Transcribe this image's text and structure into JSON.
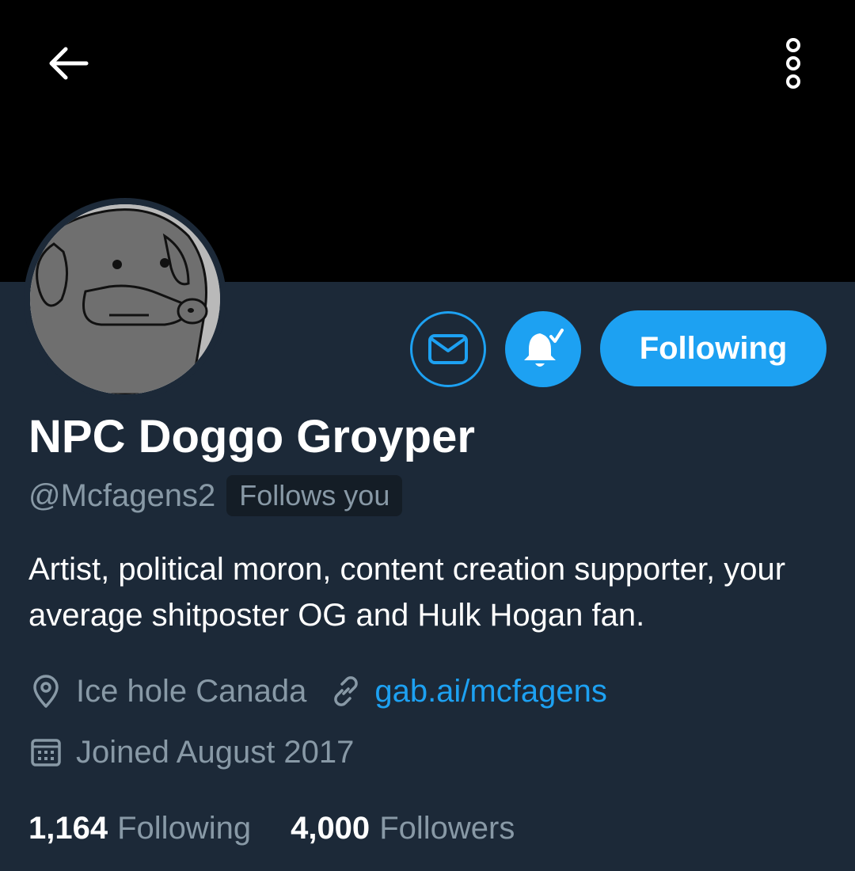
{
  "header": {
    "back_icon": "arrow-left-icon",
    "more_icon": "more-vertical-icon"
  },
  "profile": {
    "display_name": "NPC Doggo Groyper",
    "handle": "@Mcfagens2",
    "follows_you": "Follows you",
    "bio": "Artist, political moron, content creation supporter, your average shitposter OG and Hulk Hogan fan.",
    "location": "Ice hole Canada",
    "website": "gab.ai/mcfagens",
    "joined": "Joined August 2017"
  },
  "actions": {
    "message_icon": "envelope-icon",
    "notify_icon": "bell-check-icon",
    "follow_label": "Following"
  },
  "stats": {
    "following_count": "1,164",
    "following_label": "Following",
    "followers_count": "4,000",
    "followers_label": "Followers"
  },
  "colors": {
    "accent": "#1da1f2",
    "background": "#1c2938",
    "banner": "#000000",
    "secondary_text": "#8899a6"
  }
}
